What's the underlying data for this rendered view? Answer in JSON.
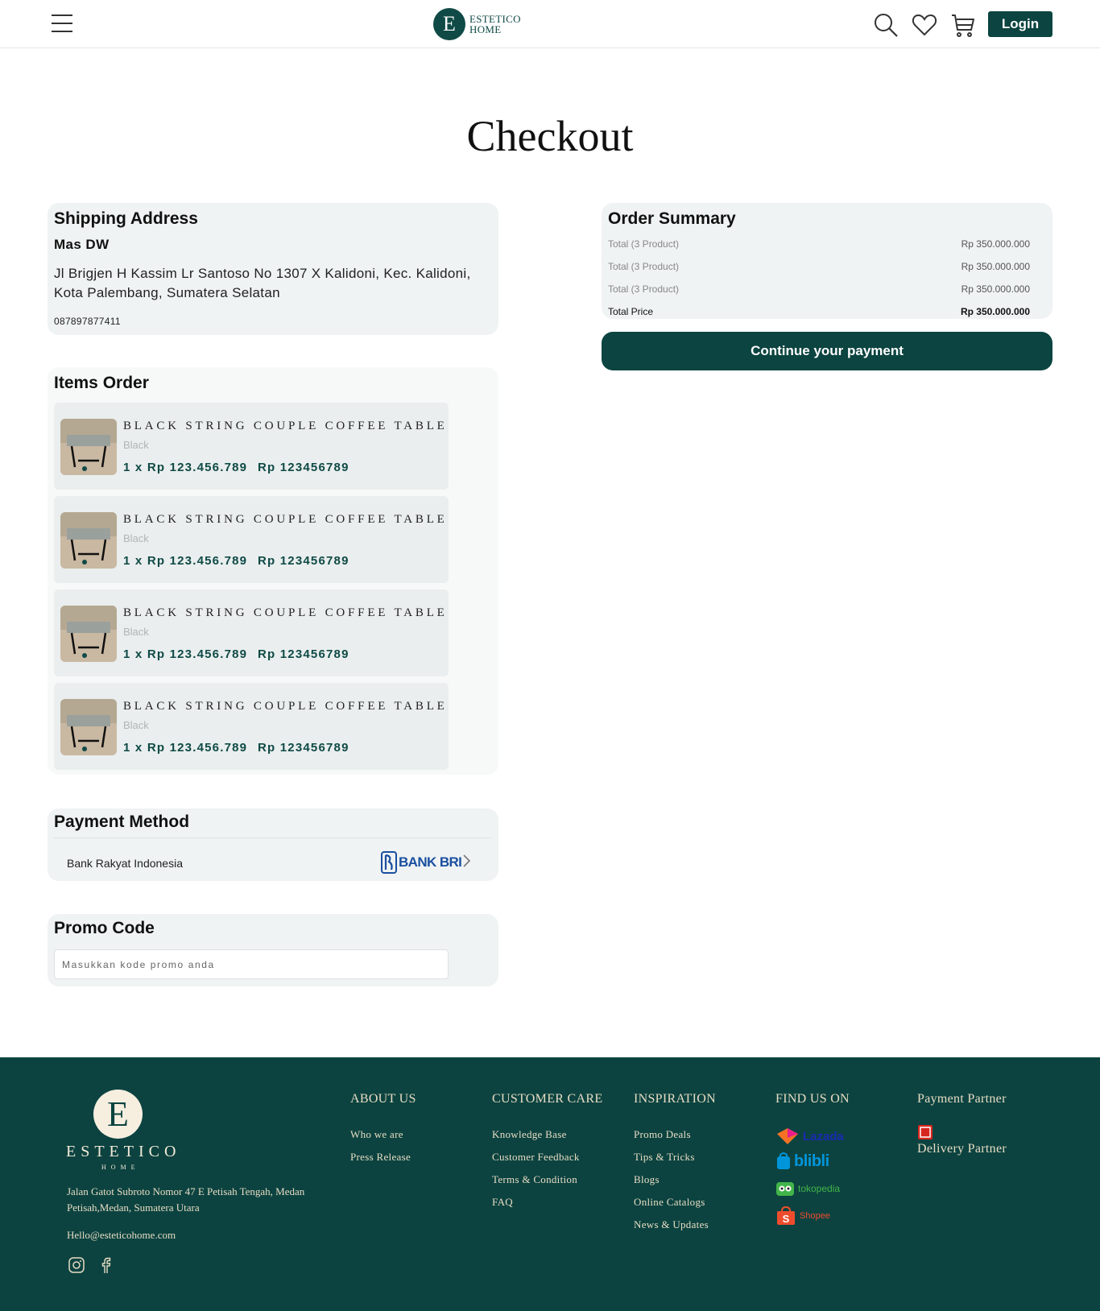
{
  "header": {
    "logo_letter": "E",
    "logo_line1": "ESTETICO",
    "logo_line2": "HOME",
    "icons": [
      "menu-icon",
      "search-icon",
      "heart-icon",
      "cart-icon"
    ],
    "login_label": "Login"
  },
  "page_title": "Checkout",
  "shipping": {
    "title": "Shipping Address",
    "name": "Mas DW",
    "address": "Jl Brigjen H Kassim Lr Santoso No 1307 X Kalidoni, Kec. Kalidoni, Kota Palembang, Sumatera Selatan",
    "phone": "087897877411"
  },
  "items_order": {
    "title": "Items Order",
    "items": [
      {
        "name": "BLACK STRING COUPLE COFFEE TABLE",
        "variant": "Black",
        "price": "1 x Rp 123.456.789",
        "total": "Rp 123456789"
      },
      {
        "name": "BLACK STRING COUPLE COFFEE TABLE",
        "variant": "Black",
        "price": "1 x Rp 123.456.789",
        "total": "Rp 123456789"
      },
      {
        "name": "BLACK STRING COUPLE COFFEE TABLE",
        "variant": "Black",
        "price": "1 x Rp 123.456.789",
        "total": "Rp 123456789"
      },
      {
        "name": "BLACK STRING COUPLE COFFEE TABLE",
        "variant": "Black",
        "price": "1 x Rp 123.456.789",
        "total": "Rp 123456789"
      }
    ]
  },
  "payment": {
    "title": "Payment Method",
    "bank_name": "Bank Rakyat Indonesia",
    "bank_logo_text": "BANK BRI"
  },
  "promo": {
    "title": "Promo Code",
    "placeholder": "Masukkan kode promo anda"
  },
  "summary": {
    "title": "Order Summary",
    "rows": [
      {
        "label": "Total (3 Product)",
        "value": "Rp 350.000.000"
      },
      {
        "label": "Total (3 Product)",
        "value": "Rp 350.000.000"
      },
      {
        "label": "Total (3 Product)",
        "value": "Rp 350.000.000"
      }
    ],
    "total_label": "Total Price",
    "total_value": "Rp 350.000.000",
    "continue_label": "Continue your payment"
  },
  "footer": {
    "brand_letter": "E",
    "brand": "ESTETICO",
    "brand_sub": "HOME",
    "address": "Jalan Gatot Subroto Nomor 47 E Petisah Tengah, Medan Petisah,Medan, Sumatera Utara",
    "email": "Hello@esteticohome.com",
    "social_icons": [
      "instagram-icon",
      "facebook-icon"
    ],
    "about": {
      "title": "ABOUT US",
      "links": [
        "Who we are",
        "Press Release"
      ]
    },
    "care": {
      "title": "CUSTOMER CARE",
      "links": [
        "Knowledge Base",
        "Customer Feedback",
        "Terms & Condition",
        "FAQ"
      ]
    },
    "inspiration": {
      "title": "INSPIRATION",
      "links": [
        "Promo Deals",
        "Tips & Tricks",
        "Blogs",
        "Online Catalogs",
        "News & Updates"
      ]
    },
    "find_us": {
      "title": "FIND US ON",
      "marketplaces": [
        "Lazada",
        "blibli",
        "tokopedia",
        "Shopee"
      ]
    },
    "payment_partner": "Payment Partner",
    "delivery_partner": "Delivery Partner",
    "colors": {
      "bg": "#0c4340",
      "text": "#e6dcc3"
    }
  },
  "colors": {
    "primary": "#0b4440",
    "card_bg": "#eff3f3"
  }
}
